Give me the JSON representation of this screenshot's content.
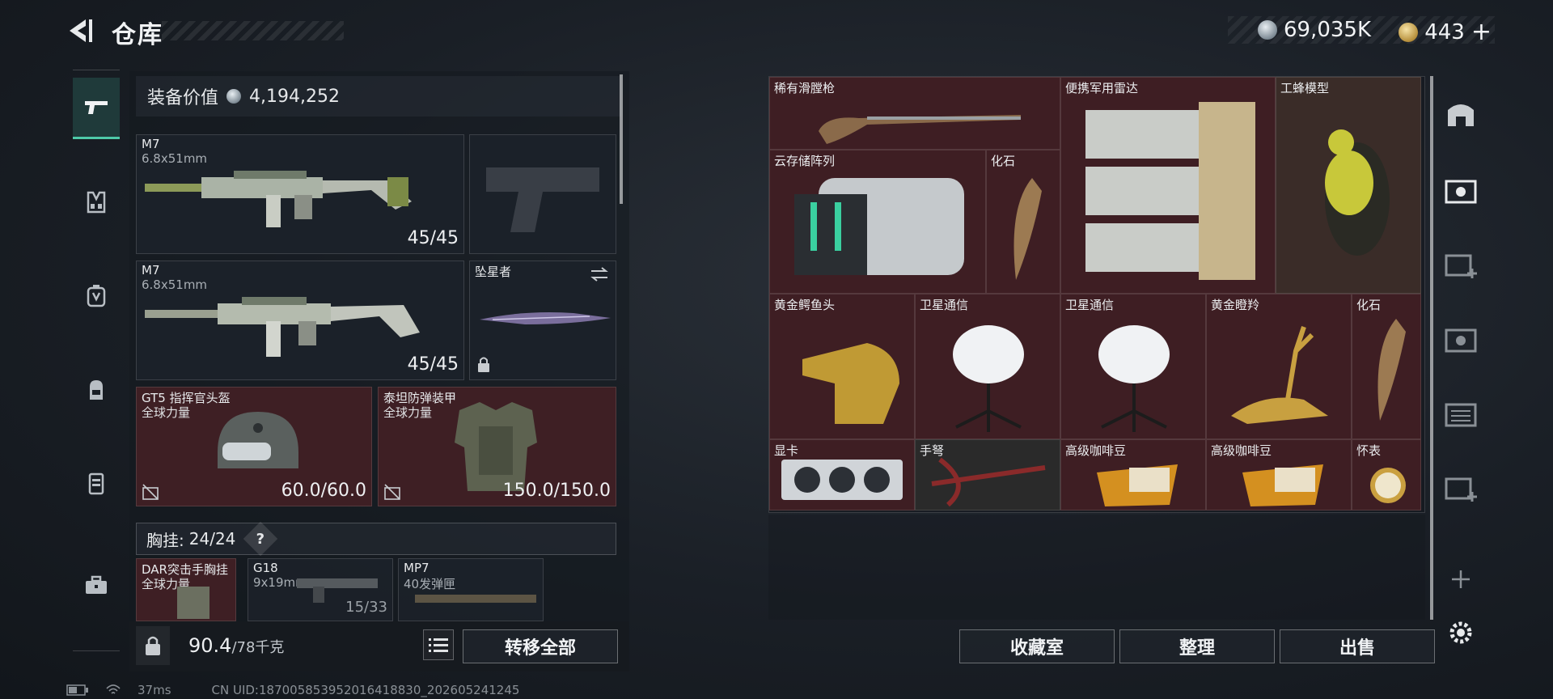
{
  "header": {
    "title": "仓库",
    "currency_silver": "69,035K",
    "currency_gold": "443",
    "add_label": "+"
  },
  "left_nav": {
    "items": [
      "pistol",
      "rig",
      "backpack-alt",
      "backpack",
      "container",
      "toolbox"
    ]
  },
  "equip_value": {
    "label": "装备价值",
    "value": "4,194,252"
  },
  "slots": {
    "primary1": {
      "name": "M7",
      "caliber": "6.8x51mm",
      "ammo": "45/45"
    },
    "secondary_empty": {},
    "primary2": {
      "name": "M7",
      "caliber": "6.8x51mm",
      "ammo": "45/45"
    },
    "melee": {
      "name": "坠星者"
    },
    "helmet": {
      "name": "GT5 指挥官头盔",
      "faction": "全球力量",
      "durability": "60.0/60.0"
    },
    "armor": {
      "name": "泰坦防弹装甲",
      "faction": "全球力量",
      "durability": "150.0/150.0"
    }
  },
  "chest_rig": {
    "label": "胸挂:",
    "capacity": "24/24",
    "help": "?"
  },
  "rig_items": [
    {
      "name": "DAR突击手胸挂",
      "sub": "全球力量"
    },
    {
      "name": "G18",
      "sub": "9x19mm",
      "count": "15/33"
    },
    {
      "name": "MP7",
      "sub": "40发弹匣"
    }
  ],
  "bottom_left": {
    "weight": "90.4",
    "weight_max": "/78千克",
    "transfer_all": "转移全部"
  },
  "storage": {
    "items": [
      {
        "name": "稀有滑膛枪"
      },
      {
        "name": "便携军用雷达"
      },
      {
        "name": "工蜂模型"
      },
      {
        "name": "云存储阵列"
      },
      {
        "name": "化石"
      },
      {
        "name": "黄金鳄鱼头"
      },
      {
        "name": "卫星通信"
      },
      {
        "name": "卫星通信"
      },
      {
        "name": "黄金瞪羚"
      },
      {
        "name": "化石"
      },
      {
        "name": "显卡"
      },
      {
        "name": "手弩"
      },
      {
        "name": "高级咖啡豆"
      },
      {
        "name": "高级咖啡豆"
      },
      {
        "name": "怀表"
      }
    ]
  },
  "bottom_right": {
    "collection": "收藏室",
    "organize": "整理",
    "sell": "出售"
  },
  "status": {
    "ping": "37ms",
    "uid": "CN UID:187005853952016418830_202605241245"
  },
  "colors": {
    "accent": "#4ec9a8",
    "item_bg_red": "#3e1e23"
  }
}
